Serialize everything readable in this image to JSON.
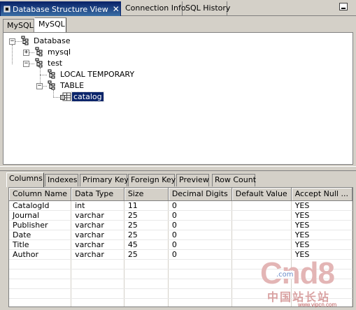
{
  "view_tabs": [
    {
      "label": "Database Structure View",
      "active": true
    },
    {
      "label": "Connection Info",
      "active": false
    },
    {
      "label": "SQL History",
      "active": false
    }
  ],
  "sub_tabs": [
    {
      "label": "MySQL",
      "active": false
    },
    {
      "label": "MySQL",
      "active": true
    }
  ],
  "tree": {
    "root": "Database",
    "nodes": [
      {
        "label": "mysql"
      },
      {
        "label": "test"
      },
      {
        "label": "LOCAL TEMPORARY"
      },
      {
        "label": "TABLE"
      },
      {
        "label": "catalog",
        "selected": true
      }
    ]
  },
  "detail_tabs": [
    "Columns",
    "Indexes",
    "Primary Key",
    "Foreign Key",
    "Preview",
    "Row Count"
  ],
  "table": {
    "headers": [
      "Column Name",
      "Data Type",
      "Size",
      "Decimal Digits",
      "Default Value",
      "Accept Null ..."
    ],
    "rows": [
      [
        "CatalogId",
        "int",
        "11",
        "0",
        "",
        "YES"
      ],
      [
        "Journal",
        "varchar",
        "25",
        "0",
        "",
        "YES"
      ],
      [
        "Publisher",
        "varchar",
        "25",
        "0",
        "",
        "YES"
      ],
      [
        "Date",
        "varchar",
        "25",
        "0",
        "",
        "YES"
      ],
      [
        "Title",
        "varchar",
        "45",
        "0",
        "",
        "YES"
      ],
      [
        "Author",
        "varchar",
        "25",
        "0",
        "",
        "YES"
      ]
    ]
  },
  "watermark": {
    "logo": "Cnd8",
    "dotcom": ".com",
    "cn_text": "中国站长站",
    "url": "www.vipcn.com"
  },
  "colors": {
    "accent": "#0a246a",
    "chrome": "#d4d0c8",
    "watermark": "#d9a2a2"
  }
}
